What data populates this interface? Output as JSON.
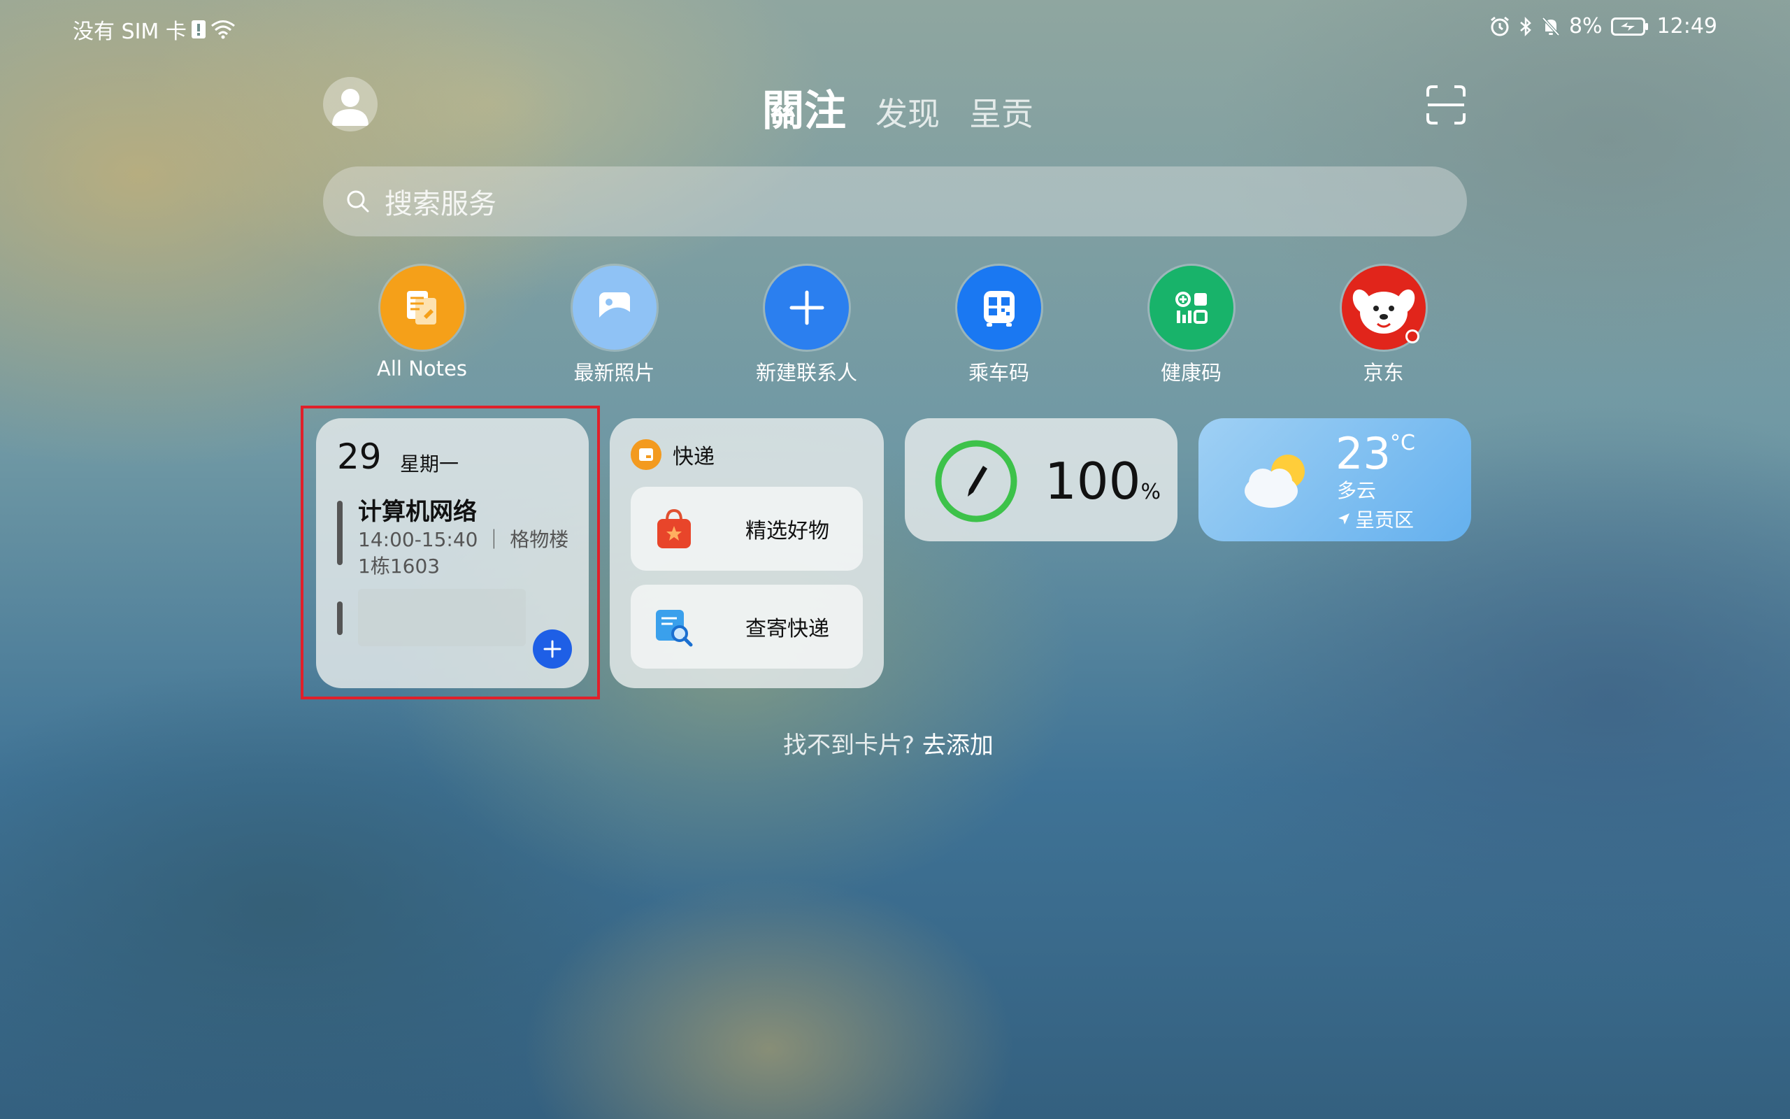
{
  "status_bar": {
    "carrier": "没有 SIM 卡",
    "battery": "8%",
    "time": "12:49"
  },
  "header": {
    "tabs": [
      {
        "label": "關注",
        "active": true
      },
      {
        "label": "发现",
        "active": false
      },
      {
        "label": "呈贡",
        "active": false
      }
    ]
  },
  "search": {
    "placeholder": "搜索服务"
  },
  "apps": [
    {
      "label": "All Notes",
      "icon": "notes-icon",
      "color": "#f5a019"
    },
    {
      "label": "最新照片",
      "icon": "gallery-icon",
      "color": "#8fc2f5"
    },
    {
      "label": "新建联系人",
      "icon": "plus-icon",
      "color": "#2b7fef"
    },
    {
      "label": "乘车码",
      "icon": "bus-qr-icon",
      "color": "#1a78f2"
    },
    {
      "label": "健康码",
      "icon": "health-code-icon",
      "color": "#18b36a"
    },
    {
      "label": "京东",
      "icon": "jd-icon",
      "color": "#e1251b"
    }
  ],
  "calendar_card": {
    "day": "29",
    "weekday": "星期一",
    "event_title": "计算机网络",
    "event_time_place": "14:00-15:40 ｜ 格物楼",
    "event_room": "1栋1603"
  },
  "express_card": {
    "title": "快递",
    "items": [
      {
        "label": "精选好物",
        "icon": "shopping-bag-icon"
      },
      {
        "label": "查寄快递",
        "icon": "package-search-icon"
      }
    ]
  },
  "storage_card": {
    "value": "100",
    "unit": "%",
    "level": 1.0,
    "ring_color": "#3dc24a"
  },
  "weather_card": {
    "temp": "23",
    "unit": "°C",
    "condition": "多云",
    "location": "呈贡区"
  },
  "footer": {
    "hint": "找不到卡片?",
    "link": "去添加"
  }
}
